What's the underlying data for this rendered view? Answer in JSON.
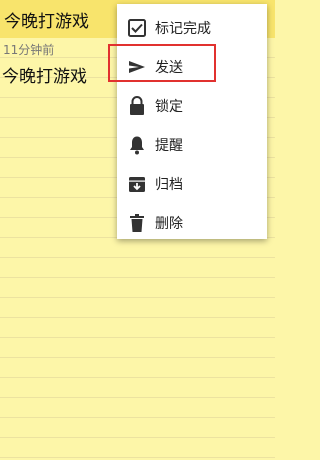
{
  "note": {
    "title": "今晚打游戏",
    "timestamp": "11分钟前",
    "content": "今晚打游戏"
  },
  "menu": {
    "items": [
      {
        "label": "标记完成",
        "icon": "checkbox-icon"
      },
      {
        "label": "发送",
        "icon": "send-icon"
      },
      {
        "label": "锁定",
        "icon": "lock-icon"
      },
      {
        "label": "提醒",
        "icon": "bell-icon"
      },
      {
        "label": "归档",
        "icon": "archive-icon"
      },
      {
        "label": "删除",
        "icon": "trash-icon"
      }
    ]
  },
  "colors": {
    "header": "#f8e46c",
    "paper": "#fdf6a8",
    "highlight": "#e1312f"
  }
}
